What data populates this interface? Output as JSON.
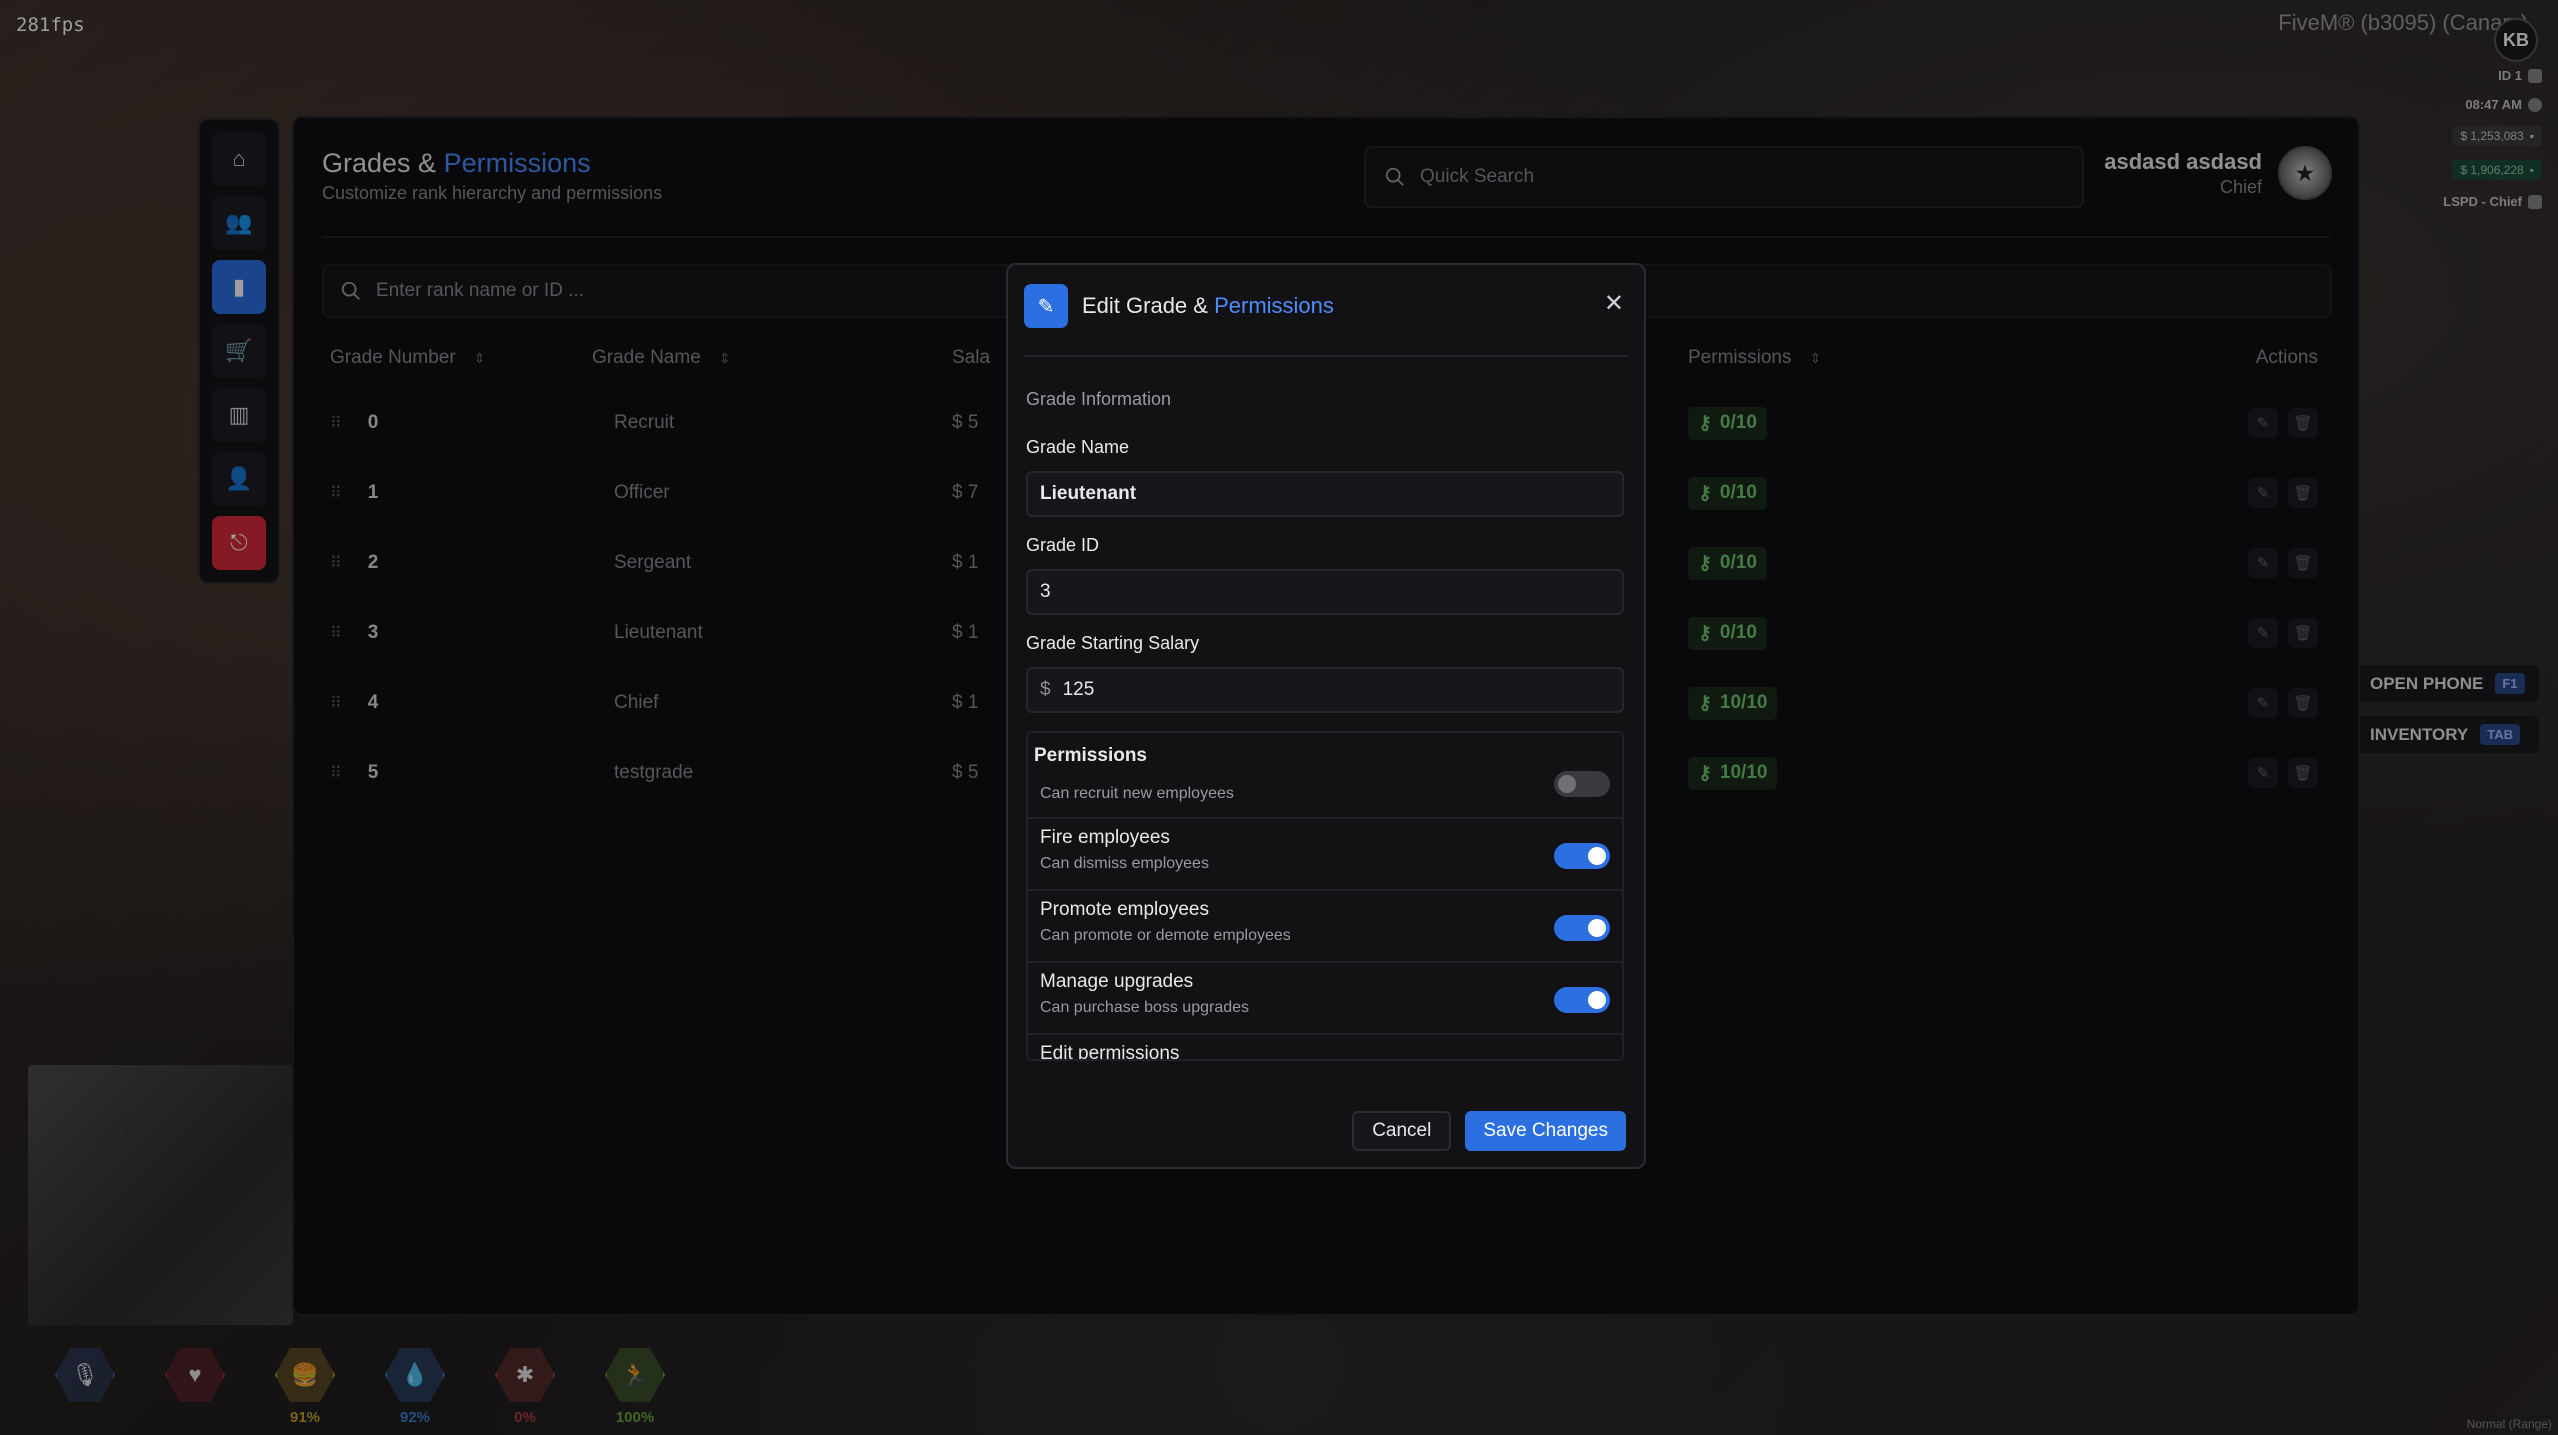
{
  "hud": {
    "fps": "281fps",
    "server_title": "FiveM® (b3095) (Canary)",
    "server_logo": "KB",
    "player_id": "ID 1",
    "time": "08:47 AM",
    "cash": "$ 1,253,083",
    "bank": "$ 1,906,228",
    "job": "LSPD - Chief",
    "hotkeys": [
      {
        "label": "OPEN PHONE",
        "key": "F1"
      },
      {
        "label": "INVENTORY",
        "key": "TAB"
      }
    ],
    "statuses": [
      {
        "icon": "microphone-icon",
        "glyph": "🎙",
        "pct": "",
        "color": "#3f63a8"
      },
      {
        "icon": "heart-icon",
        "glyph": "♥",
        "pct": "",
        "color": "#b02a3a"
      },
      {
        "icon": "food-icon",
        "glyph": "🍔",
        "pct": "91%",
        "color": "#c8a02a"
      },
      {
        "icon": "water-drop-icon",
        "glyph": "💧",
        "pct": "92%",
        "color": "#3b7fd0"
      },
      {
        "icon": "stress-icon",
        "glyph": "✱",
        "pct": "0%",
        "color": "#b04040"
      },
      {
        "icon": "stamina-icon",
        "glyph": "🏃",
        "pct": "100%",
        "color": "#6aa83a"
      }
    ],
    "corner_note": "Normal (Range)"
  },
  "sidebar": {
    "items": [
      {
        "name": "home-icon",
        "glyph": "⌂"
      },
      {
        "name": "employees-icon",
        "glyph": "👥"
      },
      {
        "name": "grades-icon",
        "glyph": "▮"
      },
      {
        "name": "shop-cart-icon",
        "glyph": "🛒"
      },
      {
        "name": "documents-icon",
        "glyph": "▥"
      },
      {
        "name": "profile-icon",
        "glyph": "👤"
      },
      {
        "name": "exit-icon",
        "glyph": "⎋"
      }
    ]
  },
  "header": {
    "title_plain": "Grades & ",
    "title_accent": "Permissions",
    "subtitle": "Customize rank hierarchy and permissions",
    "search_placeholder": "Quick Search",
    "user_name": "asdasd asdasd",
    "user_role": "Chief"
  },
  "rank_search": {
    "placeholder": "Enter rank name or ID ..."
  },
  "table": {
    "headers": {
      "grade_number": "Grade Number",
      "grade_name": "Grade Name",
      "salary": "Sala",
      "permissions": "Permissions",
      "actions": "Actions"
    },
    "rows": [
      {
        "num": "0",
        "name": "Recruit",
        "salary": "$ 5",
        "perms": "0/10"
      },
      {
        "num": "1",
        "name": "Officer",
        "salary": "$ 7",
        "perms": "0/10"
      },
      {
        "num": "2",
        "name": "Sergeant",
        "salary": "$ 1",
        "perms": "0/10"
      },
      {
        "num": "3",
        "name": "Lieutenant",
        "salary": "$ 1",
        "perms": "0/10"
      },
      {
        "num": "4",
        "name": "Chief",
        "salary": "$ 1",
        "perms": "10/10"
      },
      {
        "num": "5",
        "name": "testgrade",
        "salary": "$ 5",
        "perms": "10/10"
      }
    ]
  },
  "modal": {
    "title_plain": "Edit Grade & ",
    "title_accent": "Permissions",
    "section": "Grade Information",
    "grade_name_label": "Grade Name",
    "grade_name_value": "Lieutenant",
    "grade_id_label": "Grade ID",
    "grade_id_value": "3",
    "salary_label": "Grade Starting Salary",
    "salary_prefix": "$",
    "salary_value": "125",
    "permissions_label": "Permissions",
    "permissions": [
      {
        "title": "",
        "desc": "Can recruit new employees",
        "on": false
      },
      {
        "title": "Fire employees",
        "desc": "Can dismiss employees",
        "on": true
      },
      {
        "title": "Promote employees",
        "desc": "Can promote or demote employees",
        "on": true
      },
      {
        "title": "Manage upgrades",
        "desc": "Can purchase boss upgrades",
        "on": true
      },
      {
        "title": "Edit permissions",
        "desc": "",
        "on": false
      }
    ],
    "cancel_label": "Cancel",
    "save_label": "Save Changes"
  }
}
